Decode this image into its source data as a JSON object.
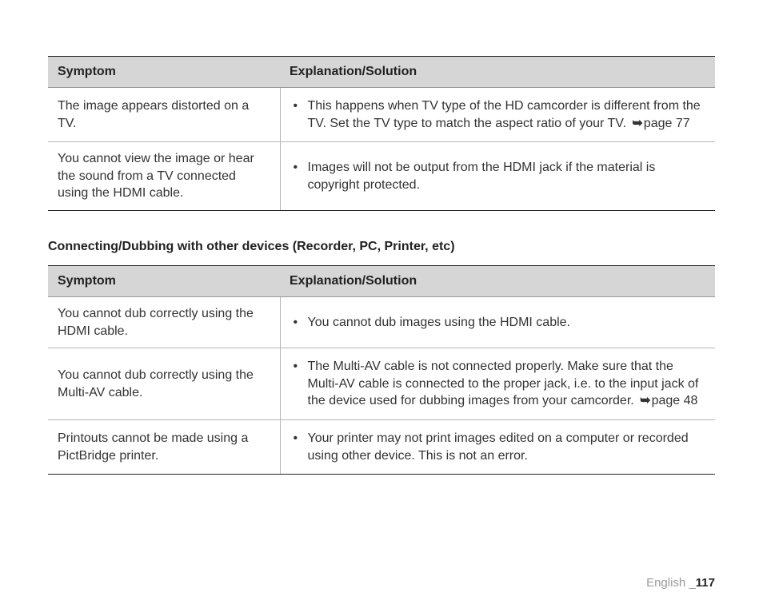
{
  "icons": {
    "arrow": "➥"
  },
  "table1": {
    "headers": {
      "symptom": "Symptom",
      "explanation": "Explanation/Solution"
    },
    "rows": [
      {
        "symptom": "The image appears distorted on a TV.",
        "bullets": [
          {
            "pre": "This happens when TV type of the HD camcorder is different from the TV. Set the TV type to match the aspect ratio of your TV. ",
            "ref": "page 77"
          }
        ]
      },
      {
        "symptom": "You cannot view the image or hear the sound from a TV connected using the HDMI cable.",
        "bullets": [
          {
            "pre": "Images will not be output from the HDMI jack if the material is copyright protected."
          }
        ]
      }
    ]
  },
  "section_heading": "Connecting/Dubbing with other devices (Recorder, PC, Printer, etc)",
  "table2": {
    "headers": {
      "symptom": "Symptom",
      "explanation": "Explanation/Solution"
    },
    "rows": [
      {
        "symptom": "You cannot dub correctly using the HDMI cable.",
        "bullets": [
          {
            "pre": "You cannot dub images using the HDMI cable."
          }
        ]
      },
      {
        "symptom": "You cannot dub correctly using the Multi-AV cable.",
        "bullets": [
          {
            "pre": "The Multi-AV cable is not connected properly. Make sure that the Multi-AV cable is connected to the proper jack, i.e. to the input jack of the device used for dubbing images from your camcorder. ",
            "ref": "page 48"
          }
        ]
      },
      {
        "symptom": "Printouts cannot be made using a PictBridge printer.",
        "bullets": [
          {
            "pre": "Your printer may not print images edited on a computer or recorded using other device. This is not an error."
          }
        ]
      }
    ]
  },
  "footer": {
    "language": "English ",
    "sep": "_",
    "page": "117"
  }
}
